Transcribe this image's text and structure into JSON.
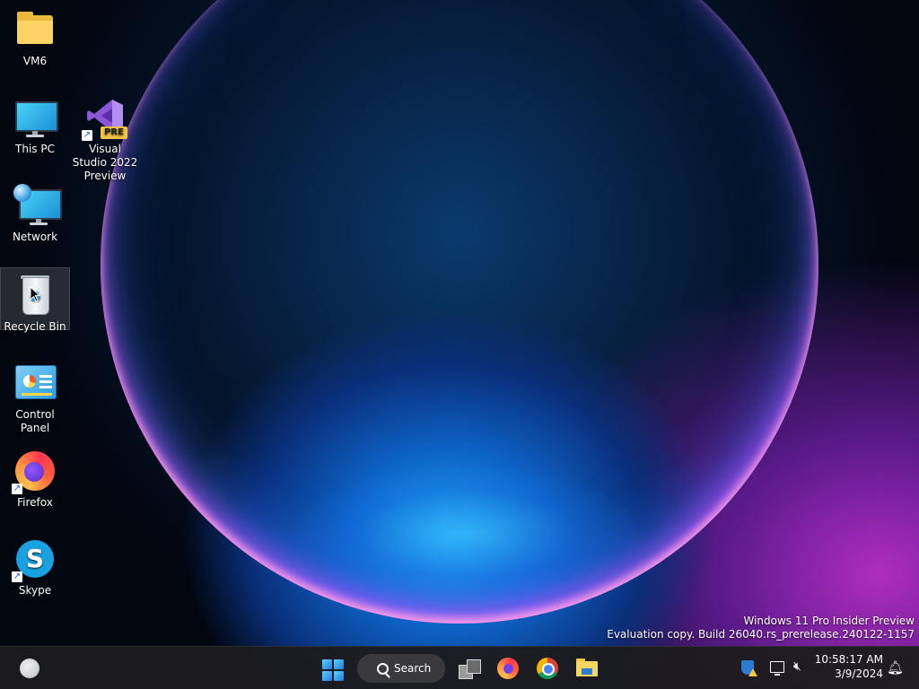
{
  "desktop": {
    "icons": [
      {
        "label": "VM6",
        "type": "folder"
      },
      {
        "label": "This PC",
        "type": "computer"
      },
      {
        "label": "Network",
        "type": "network"
      },
      {
        "label": "Recycle Bin",
        "type": "recycle-bin",
        "selected": true
      },
      {
        "label": "Control Panel",
        "type": "control-panel"
      },
      {
        "label": "Firefox",
        "type": "firefox",
        "shortcut": true
      },
      {
        "label": "Skype",
        "type": "skype",
        "shortcut": true
      },
      {
        "label": "Visual Studio 2022 Preview",
        "type": "visual-studio",
        "shortcut": true,
        "badge": "PRE"
      }
    ]
  },
  "watermark": {
    "line1": "Windows 11 Pro Insider Preview",
    "line2": "Evaluation copy. Build 26040.rs_prerelease.240122-1157"
  },
  "taskbar": {
    "search_label": "Search",
    "pinned": [
      "task-view",
      "firefox",
      "chrome",
      "file-explorer"
    ],
    "clock": {
      "time": "10:58:17 AM",
      "date": "3/9/2024"
    },
    "tray": [
      "security-icon",
      "network-icon",
      "volume-muted-icon",
      "notification-bell-icon"
    ]
  },
  "colors": {
    "taskbar_bg": "#1c1c1e",
    "accent": "#1e7ae0"
  }
}
